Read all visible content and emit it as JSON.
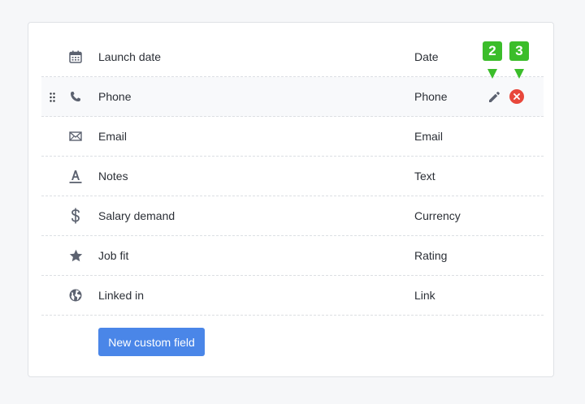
{
  "colors": {
    "accent": "#4a86e8",
    "delete": "#e8473b",
    "badge": "#3bbd2a",
    "icon": "#5c6270"
  },
  "fields": [
    {
      "icon": "calendar-icon",
      "name": "Launch date",
      "type": "Date"
    },
    {
      "icon": "phone-icon",
      "name": "Phone",
      "type": "Phone"
    },
    {
      "icon": "envelope-icon",
      "name": "Email",
      "type": "Email"
    },
    {
      "icon": "text-icon",
      "name": "Notes",
      "type": "Text"
    },
    {
      "icon": "dollar-icon",
      "name": "Salary demand",
      "type": "Currency"
    },
    {
      "icon": "star-icon",
      "name": "Job fit",
      "type": "Rating"
    },
    {
      "icon": "globe-icon",
      "name": "Linked in",
      "type": "Link"
    }
  ],
  "annotations": {
    "edit_badge": "2",
    "delete_badge": "3"
  },
  "actions": {
    "new_field_label": "New custom field"
  }
}
